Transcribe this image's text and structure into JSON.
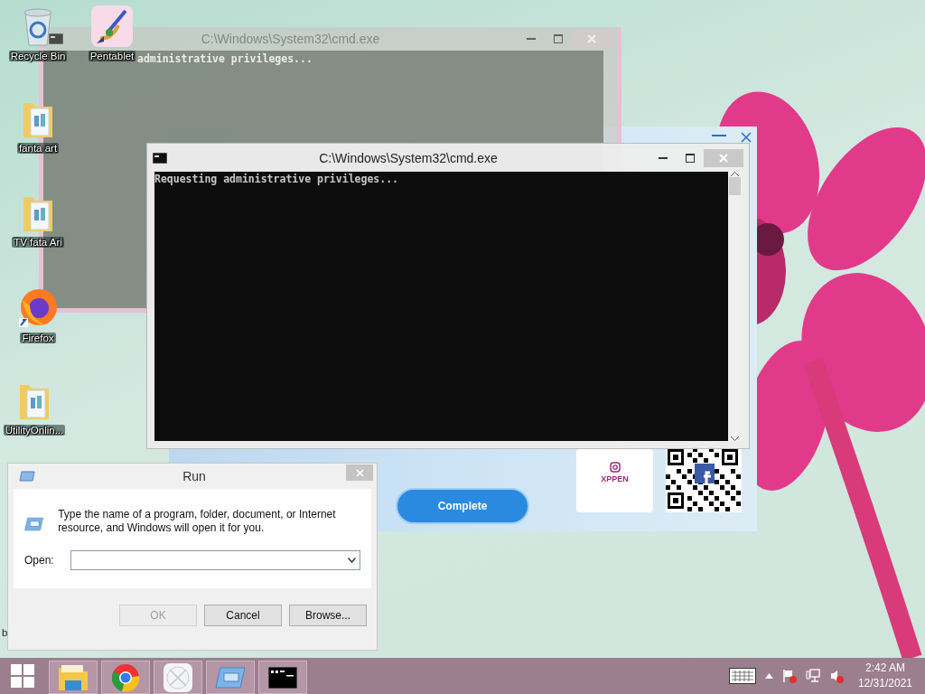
{
  "desktop_icons": [
    {
      "kind": "recycle-bin",
      "label": "Recycle Bin"
    },
    {
      "kind": "app",
      "label": "Pentablet"
    },
    {
      "kind": "folder",
      "label": "fanta art"
    },
    {
      "kind": "folder",
      "label": "TV  fata Ari"
    },
    {
      "kind": "browser",
      "label": "Firefox"
    },
    {
      "kind": "folder",
      "label": "UtilityOnlin..."
    },
    {
      "kind": "partial",
      "label": "b"
    }
  ],
  "installer": {
    "button": "Complete",
    "card_label": "XPPEN"
  },
  "console_behind": {
    "title": "C:\\Windows\\System32\\cmd.exe",
    "output": "administrative privileges..."
  },
  "console": {
    "title": "C:\\Windows\\System32\\cmd.exe",
    "output": "Requesting administrative privileges..."
  },
  "run_dialog": {
    "title": "Run",
    "message": "Type the name of a program, folder, document, or Internet resource, and Windows will open it for you.",
    "open_label": "Open:",
    "buttons": [
      {
        "label": "OK",
        "disabled": true
      },
      {
        "label": "Cancel",
        "disabled": false
      },
      {
        "label": "Browse...",
        "disabled": false
      }
    ]
  },
  "taskbar": {
    "apps": [
      {
        "kind": "file-manager"
      },
      {
        "kind": "browser"
      },
      {
        "kind": "pen-app"
      },
      {
        "kind": "run"
      },
      {
        "kind": "console"
      }
    ],
    "time": "2:42 AM",
    "date": "12/31/2021"
  }
}
